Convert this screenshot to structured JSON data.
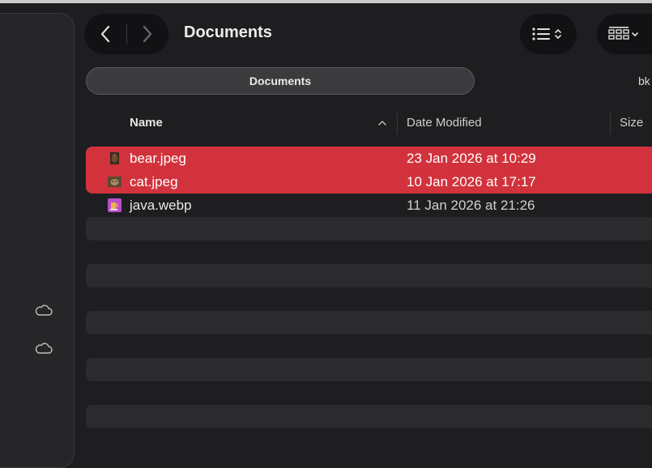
{
  "window": {
    "title": "Documents"
  },
  "toolbar": {
    "back_icon": "chevron-left-icon",
    "forward_icon": "chevron-right-icon",
    "list_view_icon": "list-view-icon",
    "grid_view_icon": "grid-view-icon"
  },
  "path_tabs": [
    {
      "label": "Documents"
    },
    {
      "label": "bk"
    }
  ],
  "columns": {
    "name": "Name",
    "date_modified": "Date Modified",
    "size": "Size"
  },
  "files": [
    {
      "name": "bear.jpeg",
      "date": "23 Jan 2026 at 10:29",
      "selected": true
    },
    {
      "name": "cat.jpeg",
      "date": "10 Jan 2026 at 17:17",
      "selected": true
    },
    {
      "name": "java.webp",
      "date": "11 Jan 2026 at 21:26",
      "selected": false
    }
  ],
  "colors": {
    "selection": "#d2323c",
    "background": "#1e1e20",
    "stripe": "#2b2b2e"
  }
}
